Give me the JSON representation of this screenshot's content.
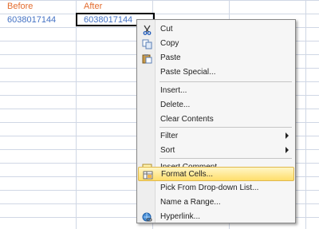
{
  "sheet": {
    "col_a_header": "Before",
    "col_b_header": "After",
    "col_a_value": "6038017144",
    "col_b_value": "6038017144"
  },
  "menu": {
    "items": [
      {
        "label": "Cut",
        "icon": "scissors-icon"
      },
      {
        "label": "Copy",
        "icon": "copy-icon"
      },
      {
        "label": "Paste",
        "icon": "paste-icon"
      },
      {
        "label": "Paste Special..."
      },
      {
        "label": "Insert..."
      },
      {
        "label": "Delete..."
      },
      {
        "label": "Clear Contents"
      },
      {
        "label": "Filter"
      },
      {
        "label": "Sort"
      },
      {
        "label": "Insert Comment",
        "icon": "comment-icon"
      },
      {
        "label": "Format Cells...",
        "icon": "format-cells-icon"
      },
      {
        "label": "Pick From Drop-down List..."
      },
      {
        "label": "Name a Range..."
      },
      {
        "label": "Hyperlink...",
        "icon": "hyperlink-icon"
      }
    ],
    "highlight_color": "#ffde6b"
  }
}
